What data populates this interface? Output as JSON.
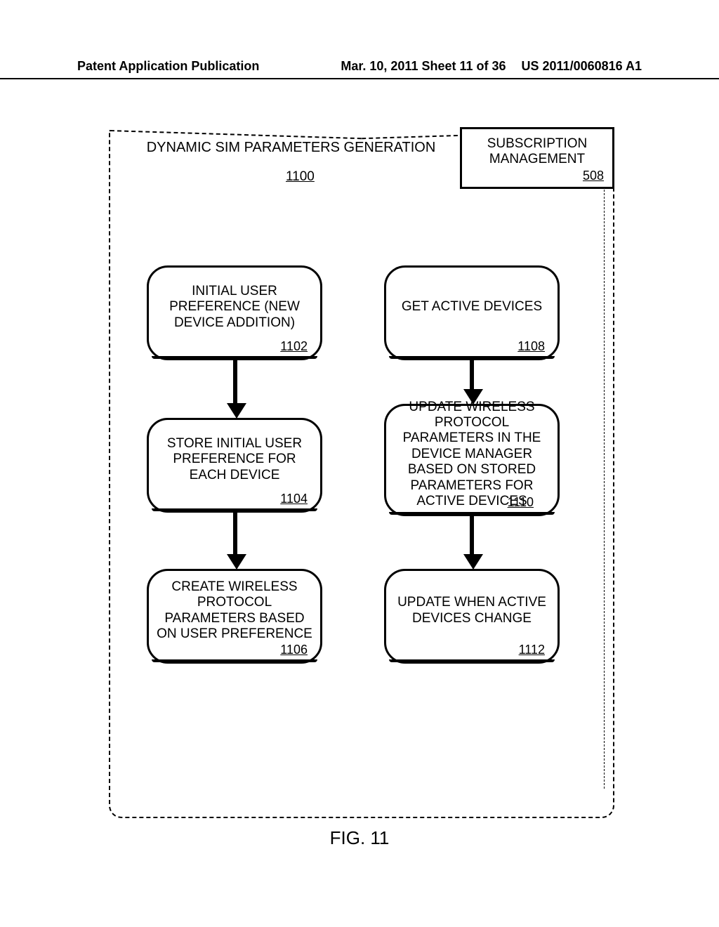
{
  "header": {
    "left": "Patent Application Publication",
    "center": "Mar. 10, 2011  Sheet 11 of 36",
    "right": "US 2011/0060816 A1"
  },
  "diagram": {
    "title": "DYNAMIC SIM PARAMETERS GENERATION",
    "title_ref": "1100",
    "sub_mgmt": {
      "label": "SUBSCRIPTION MANAGEMENT",
      "ref": "508"
    },
    "boxes": {
      "b1102": {
        "text": "INITIAL USER PREFERENCE (NEW DEVICE ADDITION)",
        "ref": "1102"
      },
      "b1104": {
        "text": "STORE INITIAL USER PREFERENCE FOR EACH DEVICE",
        "ref": "1104"
      },
      "b1106": {
        "text": "CREATE WIRELESS PROTOCOL PARAMETERS BASED ON USER PREFERENCE",
        "ref": "1106"
      },
      "b1108": {
        "text": "GET ACTIVE DEVICES",
        "ref": "1108"
      },
      "b1110": {
        "text": "UPDATE WIRELESS PROTOCOL PARAMETERS IN THE DEVICE MANAGER BASED ON STORED PARAMETERS FOR ACTIVE DEVICES",
        "ref": "1110"
      },
      "b1112": {
        "text": "UPDATE WHEN ACTIVE DEVICES CHANGE",
        "ref": "1112"
      }
    },
    "flows": [
      [
        "b1102",
        "b1104"
      ],
      [
        "b1104",
        "b1106"
      ],
      [
        "b1108",
        "b1110"
      ],
      [
        "b1110",
        "b1112"
      ]
    ]
  },
  "figure_label": "FIG. 11",
  "chart_data": {
    "type": "flow-diagram",
    "container": {
      "id": "1100",
      "label": "DYNAMIC SIM PARAMETERS GENERATION",
      "parent": {
        "id": "508",
        "label": "SUBSCRIPTION MANAGEMENT"
      }
    },
    "nodes": [
      {
        "id": "1102",
        "label": "INITIAL USER PREFERENCE (NEW DEVICE ADDITION)"
      },
      {
        "id": "1104",
        "label": "STORE INITIAL USER PREFERENCE FOR EACH DEVICE"
      },
      {
        "id": "1106",
        "label": "CREATE WIRELESS PROTOCOL PARAMETERS BASED ON USER PREFERENCE"
      },
      {
        "id": "1108",
        "label": "GET ACTIVE DEVICES"
      },
      {
        "id": "1110",
        "label": "UPDATE WIRELESS PROTOCOL PARAMETERS IN THE DEVICE MANAGER BASED ON STORED PARAMETERS FOR ACTIVE DEVICES"
      },
      {
        "id": "1112",
        "label": "UPDATE WHEN ACTIVE DEVICES CHANGE"
      }
    ],
    "edges": [
      {
        "from": "1102",
        "to": "1104"
      },
      {
        "from": "1104",
        "to": "1106"
      },
      {
        "from": "1108",
        "to": "1110"
      },
      {
        "from": "1110",
        "to": "1112"
      }
    ]
  }
}
